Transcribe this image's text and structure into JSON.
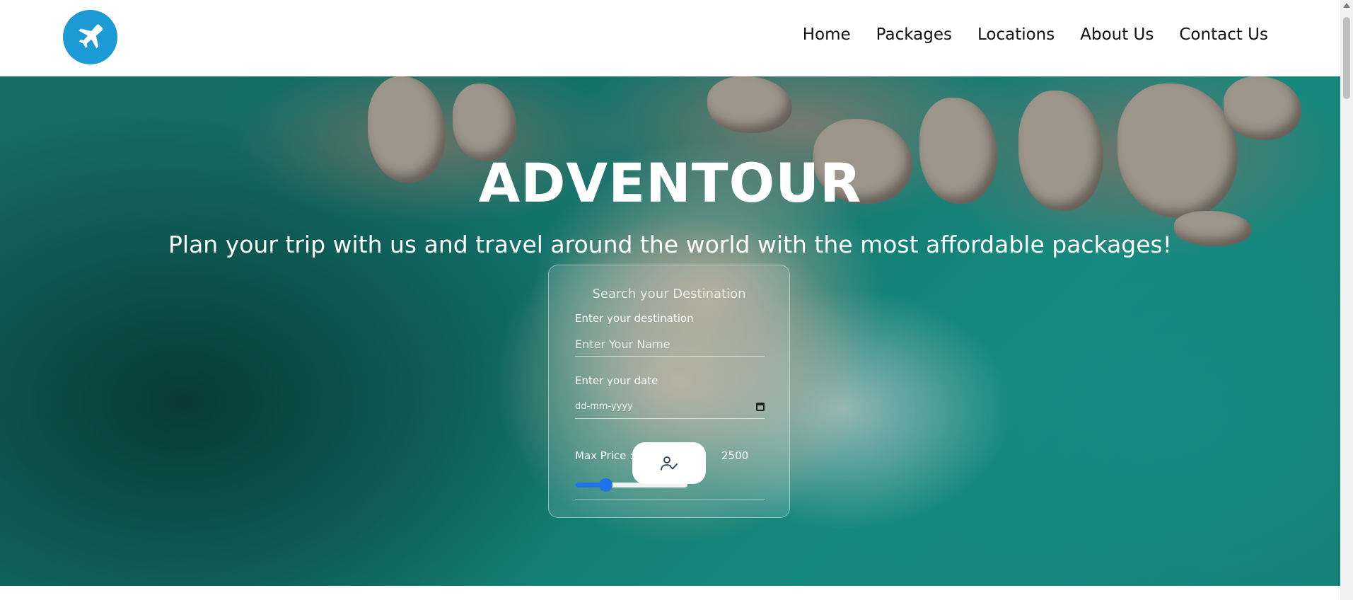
{
  "nav": {
    "logo_icon": "airplane-icon",
    "links": [
      "Home",
      "Packages",
      "Locations",
      "About Us",
      "Contact Us"
    ]
  },
  "hero": {
    "title": "ADVENTOUR",
    "subtitle": "Plan your trip with us and travel around the world with the most affordable packages!"
  },
  "search": {
    "heading": "Search your Destination",
    "destination_label": "Enter your destination",
    "destination_placeholder": "Enter Your Name",
    "destination_value": "",
    "date_label": "Enter your date",
    "date_placeholder": "dd-mm-yyyy",
    "price_label": "Max Price :",
    "price_value": "2500",
    "price_slider_fraction": 0.27,
    "submit_icon": "user-check-icon"
  },
  "colors": {
    "accent": "#1f73ea",
    "logo_bg": "#1c9ad6"
  }
}
